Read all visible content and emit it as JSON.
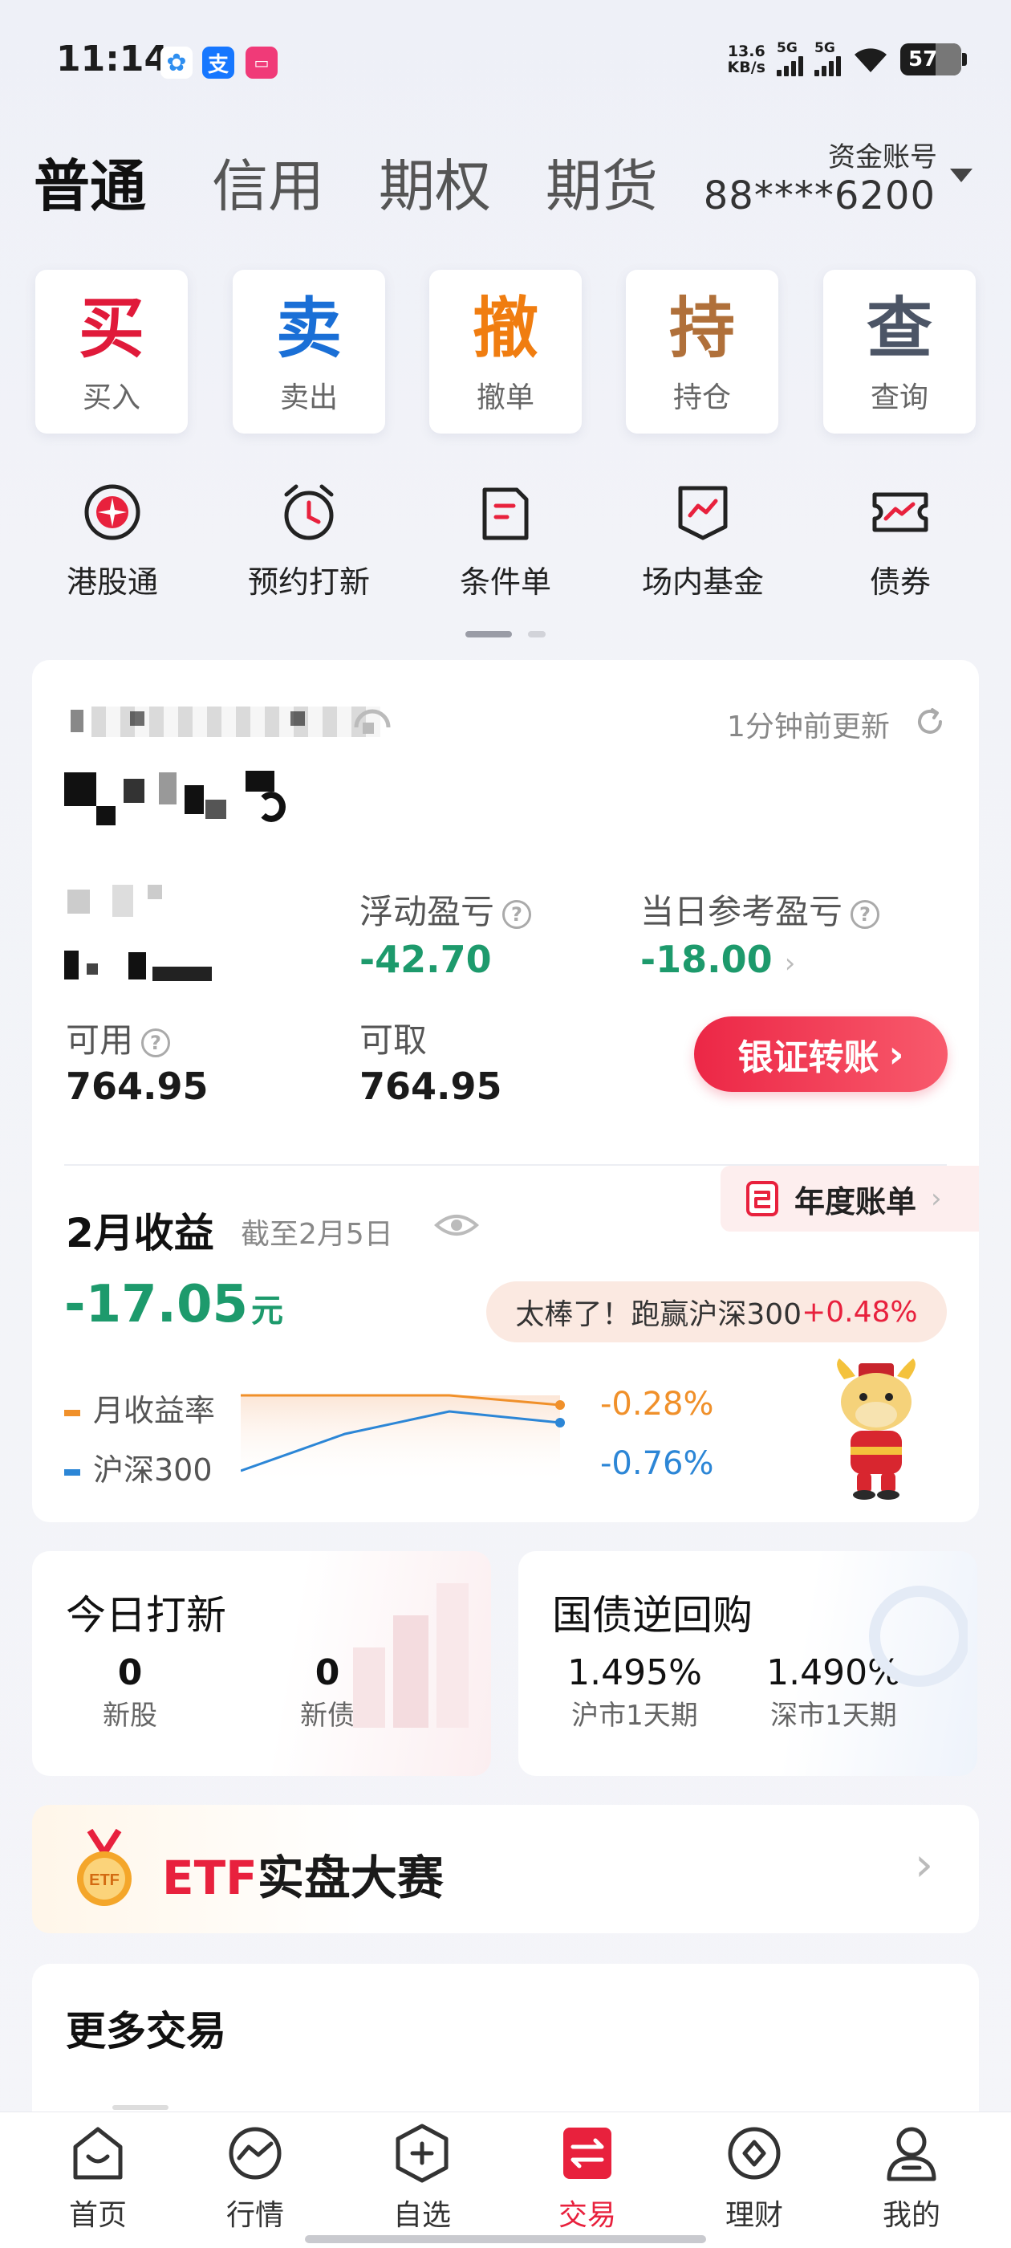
{
  "status": {
    "time": "11:14",
    "speed": "13.6",
    "speed_unit": "KB/s",
    "net1": "5G",
    "net2": "5G",
    "battery": "57"
  },
  "tabs": [
    "普通",
    "信用",
    "期权",
    "期货"
  ],
  "account": {
    "label": "资金账号",
    "number": "88****6200"
  },
  "actions": [
    {
      "glyph": "买",
      "label": "买入",
      "color": "#e01a3a"
    },
    {
      "glyph": "卖",
      "label": "卖出",
      "color": "#1a6fd6"
    },
    {
      "glyph": "撤",
      "label": "撤单",
      "color": "#f07d10"
    },
    {
      "glyph": "持",
      "label": "持仓",
      "color": "#b0703a"
    },
    {
      "glyph": "查",
      "label": "查询",
      "color": "#4c5566"
    }
  ],
  "shortcuts": [
    {
      "label": "港股通",
      "icon": "hk-flower-icon"
    },
    {
      "label": "预约打新",
      "icon": "alarm-clock-icon"
    },
    {
      "label": "条件单",
      "icon": "condition-order-icon"
    },
    {
      "label": "场内基金",
      "icon": "fund-chart-icon"
    },
    {
      "label": "债券",
      "icon": "bond-ticket-icon"
    }
  ],
  "assets": {
    "update_text": "1分钟前更新",
    "floating_pl_label": "浮动盈亏",
    "floating_pl_value": "-42.70",
    "daily_pl_label": "当日参考盈亏",
    "daily_pl_value": "-18.00",
    "available_label": "可用",
    "available_value": "764.95",
    "withdrawable_label": "可取",
    "withdrawable_value": "764.95",
    "transfer_button": "银证转账"
  },
  "monthly": {
    "title": "2月收益",
    "as_of": "截至2月5日",
    "amount": "-17.05",
    "amount_unit": "元",
    "annual_bill": "年度账单",
    "compare_prefix": "太棒了！跑赢沪深300",
    "compare_value": "+0.48%",
    "compare_color": "#e8213d",
    "legend_monthly": "月收益率",
    "legend_hs300": "沪深300",
    "monthly_rate": "-0.28%",
    "hs300_rate": "-0.76%",
    "monthly_color": "#f0902a",
    "hs300_color": "#2c86d6"
  },
  "ipo": {
    "title": "今日打新",
    "stock_count": "0",
    "stock_label": "新股",
    "bond_count": "0",
    "bond_label": "新债"
  },
  "repo": {
    "title": "国债逆回购",
    "sh_rate": "1.495%",
    "sh_label": "沪市1天期",
    "sz_rate": "1.490%",
    "sz_label": "深市1天期"
  },
  "etf_banner": {
    "badge": "ETF",
    "prefix": "ETF",
    "suffix": "实盘大赛"
  },
  "more_trading": {
    "title": "更多交易"
  },
  "nav": [
    {
      "label": "首页",
      "icon": "home-icon"
    },
    {
      "label": "行情",
      "icon": "market-icon"
    },
    {
      "label": "自选",
      "icon": "watchlist-icon"
    },
    {
      "label": "交易",
      "icon": "trade-icon"
    },
    {
      "label": "理财",
      "icon": "wealth-icon"
    },
    {
      "label": "我的",
      "icon": "profile-icon"
    }
  ],
  "accent": "#e8213d"
}
